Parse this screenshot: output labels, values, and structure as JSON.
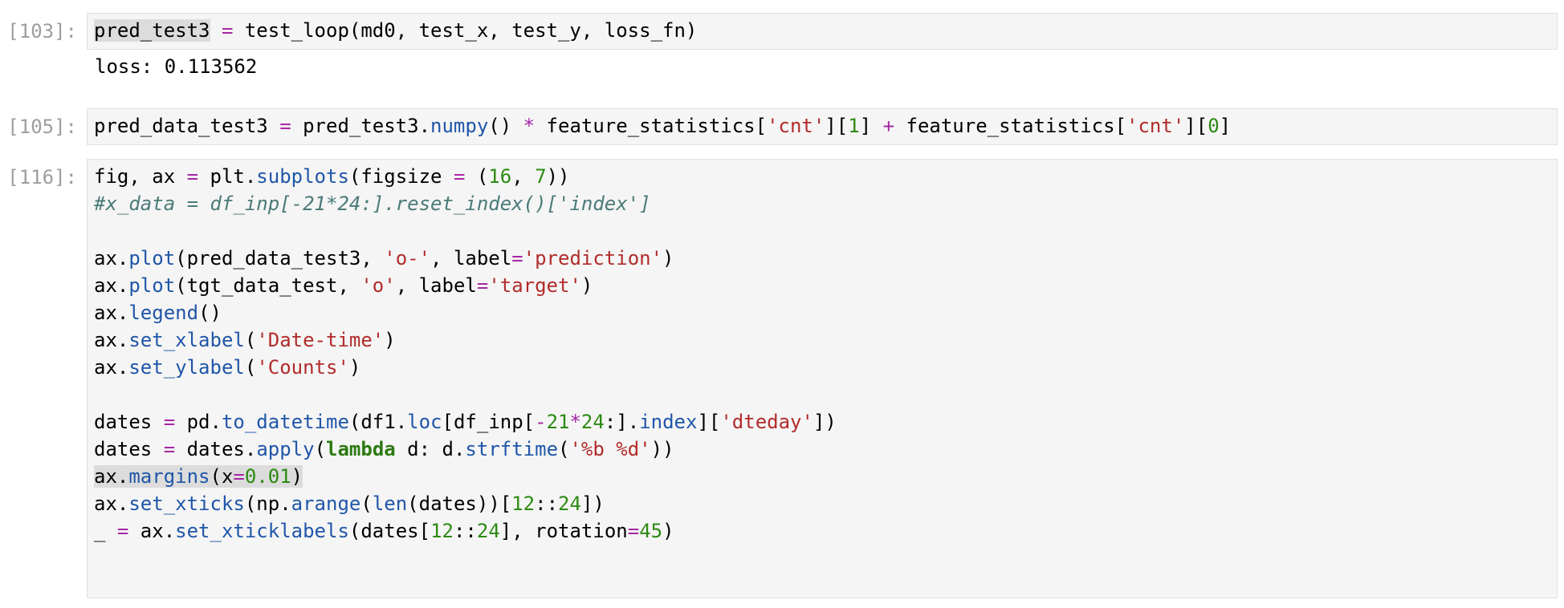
{
  "cells": [
    {
      "prompt": "[103]:",
      "code": {
        "t1": "pred_test3",
        "t2": " ",
        "t3": "=",
        "t4": " test_loop(md0, test_x, test_y, loss_fn)"
      },
      "output": "loss: 0.113562"
    },
    {
      "prompt": "[105]:",
      "code": {
        "t1": "pred_data_test3 ",
        "t2": "=",
        "t3": " pred_test3.",
        "t4": "numpy",
        "t5": "() ",
        "t6": "*",
        "t7": " feature_statistics[",
        "t8": "'cnt'",
        "t9": "][",
        "t10": "1",
        "t11": "] ",
        "t12": "+",
        "t13": " feature_statistics[",
        "t14": "'cnt'",
        "t15": "][",
        "t16": "0",
        "t17": "]"
      }
    },
    {
      "prompt": "[116]:",
      "lines": {
        "l1": {
          "a": "fig, ax ",
          "b": "=",
          "c": " plt.",
          "d": "subplots",
          "e": "(figsize ",
          "f": "=",
          "g": " (",
          "h": "16",
          "i": ", ",
          "j": "7",
          "k": "))"
        },
        "l2": {
          "a": "#x_data = df_inp[-21*24:].reset_index()['index']"
        },
        "l4": {
          "a": "ax.",
          "b": "plot",
          "c": "(pred_data_test3, ",
          "d": "'o-'",
          "e": ", label",
          "f": "=",
          "g": "'prediction'",
          "h": ")"
        },
        "l5": {
          "a": "ax.",
          "b": "plot",
          "c": "(tgt_data_test, ",
          "d": "'o'",
          "e": ", label",
          "f": "=",
          "g": "'target'",
          "h": ")"
        },
        "l6": {
          "a": "ax.",
          "b": "legend",
          "c": "()"
        },
        "l7": {
          "a": "ax.",
          "b": "set_xlabel",
          "c": "(",
          "d": "'Date-time'",
          "e": ")"
        },
        "l8": {
          "a": "ax.",
          "b": "set_ylabel",
          "c": "(",
          "d": "'Counts'",
          "e": ")"
        },
        "l10": {
          "a": "dates ",
          "b": "=",
          "c": " pd.",
          "d": "to_datetime",
          "e": "(df1.",
          "f": "loc",
          "g": "[df_inp[",
          "h": "-",
          "i": "21",
          "j": "*",
          "k": "24",
          "l": ":].",
          "m": "index",
          "n": "][",
          "o": "'dteday'",
          "p": "])"
        },
        "l11": {
          "a": "dates ",
          "b": "=",
          "c": " dates.",
          "d": "apply",
          "e": "(",
          "f": "lambda",
          "g": " d: d.",
          "h": "strftime",
          "i": "(",
          "j": "'%b %d'",
          "k": "))"
        },
        "l12": {
          "a": "ax.",
          "b": "margins",
          "c": "(x",
          "d": "=",
          "e": "0.01",
          "f": ")"
        },
        "l13": {
          "a": "ax.",
          "b": "set_xticks",
          "c": "(np.",
          "d": "arange",
          "e": "(",
          "f": "len",
          "g": "(dates))[",
          "h": "12",
          "i": "::",
          "j": "24",
          "k": "])"
        },
        "l14": {
          "a": "_ ",
          "b": "=",
          "c": " ax.",
          "d": "set_xticklabels",
          "e": "(dates[",
          "f": "12",
          "g": "::",
          "h": "24",
          "i": "], rotation",
          "j": "=",
          "k": "45",
          "l": ")"
        }
      }
    }
  ]
}
